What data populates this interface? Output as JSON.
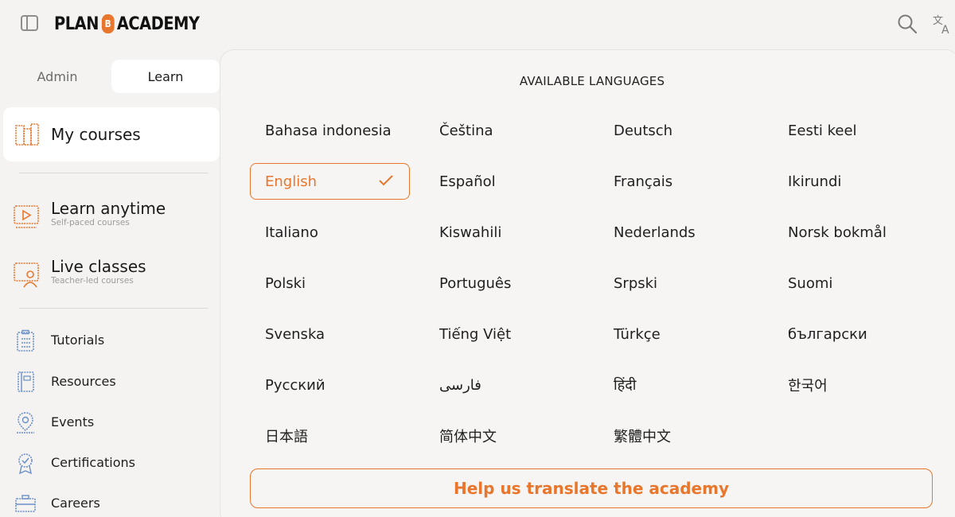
{
  "header": {
    "logo_left": "PLAN",
    "logo_badge": "B",
    "logo_right": "ACADEMY",
    "icons": [
      "sidebar-toggle-icon",
      "search-icon",
      "translate-icon"
    ]
  },
  "sidebar": {
    "tabs": [
      {
        "label": "Admin",
        "active": false
      },
      {
        "label": "Learn",
        "active": true
      }
    ],
    "my_courses": "My courses",
    "primary": [
      {
        "label": "Learn anytime",
        "sub": "Self-paced courses",
        "icon": "video-icon"
      },
      {
        "label": "Live classes",
        "sub": "Teacher-led courses",
        "icon": "teacher-icon"
      }
    ],
    "secondary": [
      {
        "label": "Tutorials",
        "icon": "clipboard-icon"
      },
      {
        "label": "Resources",
        "icon": "book-icon"
      },
      {
        "label": "Events",
        "icon": "location-pin-icon"
      },
      {
        "label": "Certifications",
        "icon": "certificate-icon"
      },
      {
        "label": "Careers",
        "icon": "briefcase-icon"
      }
    ]
  },
  "languages_panel": {
    "title": "AVAILABLE LANGUAGES",
    "selected": "English",
    "languages": [
      "Bahasa indonesia",
      "Čeština",
      "Deutsch",
      "Eesti keel",
      "English",
      "Español",
      "Français",
      "Ikirundi",
      "Italiano",
      "Kiswahili",
      "Nederlands",
      "Norsk bokmål",
      "Polski",
      "Português",
      "Srpski",
      "Suomi",
      "Svenska",
      "Tiếng Việt",
      "Türkçe",
      "български",
      "Русский",
      "فارسی",
      "हिंदी",
      "한국어",
      "日本語",
      "简体中文",
      "繁體中文"
    ],
    "help_button": "Help us translate the academy"
  },
  "colors": {
    "accent": "#e8762d",
    "background": "#f4f3f1",
    "panel": "#f6f5f3",
    "sidebar_icon_blue": "#6b8fc7"
  }
}
